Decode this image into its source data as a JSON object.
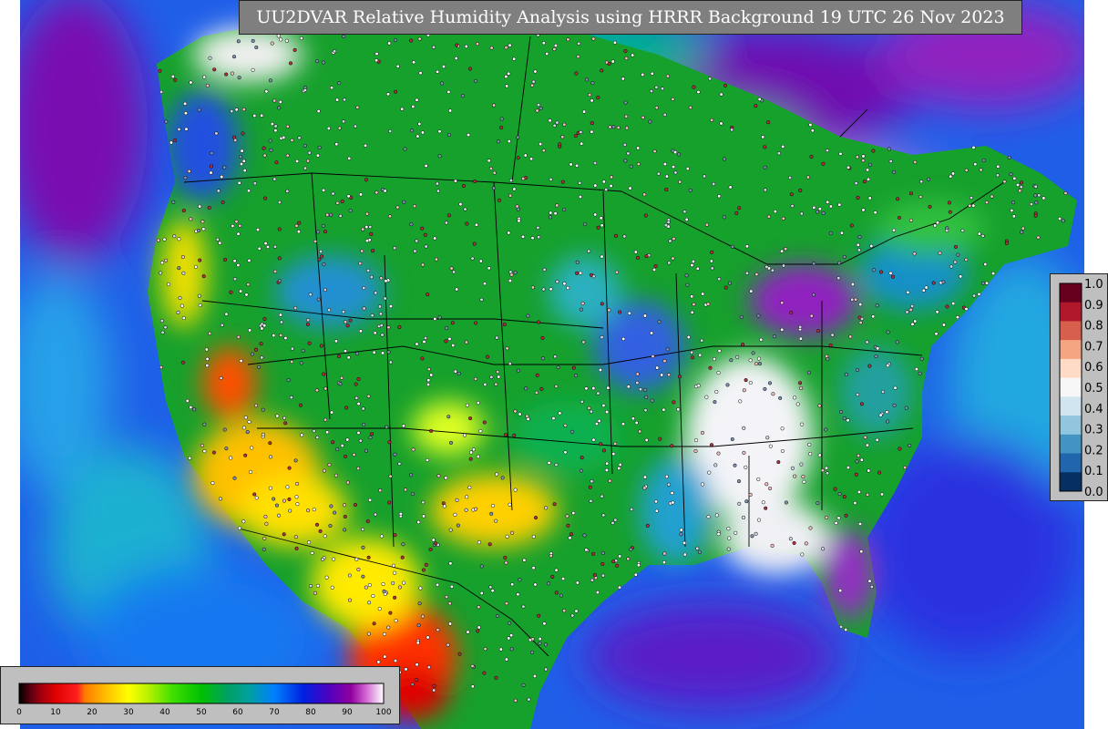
{
  "title": "UU2DVAR Relative Humidity Analysis using HRRR Background 19 UTC 26 Nov 2023",
  "rh_colorbar": {
    "ticks": [
      "0",
      "10",
      "20",
      "30",
      "40",
      "50",
      "60",
      "70",
      "80",
      "90",
      "100"
    ],
    "stops": [
      {
        "v": 0,
        "c": "#000000"
      },
      {
        "v": 3,
        "c": "#5a0010"
      },
      {
        "v": 6,
        "c": "#a00010"
      },
      {
        "v": 10,
        "c": "#e00000"
      },
      {
        "v": 16,
        "c": "#ff2020"
      },
      {
        "v": 18,
        "c": "#ff7a00"
      },
      {
        "v": 24,
        "c": "#ffc000"
      },
      {
        "v": 30,
        "c": "#ffff00"
      },
      {
        "v": 36,
        "c": "#b0f000"
      },
      {
        "v": 42,
        "c": "#40e000"
      },
      {
        "v": 50,
        "c": "#00c000"
      },
      {
        "v": 57,
        "c": "#00a060"
      },
      {
        "v": 63,
        "c": "#00a0a0"
      },
      {
        "v": 70,
        "c": "#0080ff"
      },
      {
        "v": 78,
        "c": "#0020e0"
      },
      {
        "v": 85,
        "c": "#5000c0"
      },
      {
        "v": 91,
        "c": "#9000a0"
      },
      {
        "v": 95,
        "c": "#d060d0"
      },
      {
        "v": 100,
        "c": "#ffffff"
      }
    ]
  },
  "ratio_colorbar": {
    "ticks": [
      "1.0",
      "0.9",
      "0.8",
      "0.7",
      "0.6",
      "0.5",
      "0.4",
      "0.3",
      "0.2",
      "0.1",
      "0.0"
    ],
    "colors": [
      "#67001f",
      "#b2182b",
      "#d6604d",
      "#f4a582",
      "#fddbc7",
      "#f7f7f7",
      "#d1e5f0",
      "#92c5de",
      "#4393c3",
      "#2166ac",
      "#053061"
    ]
  }
}
